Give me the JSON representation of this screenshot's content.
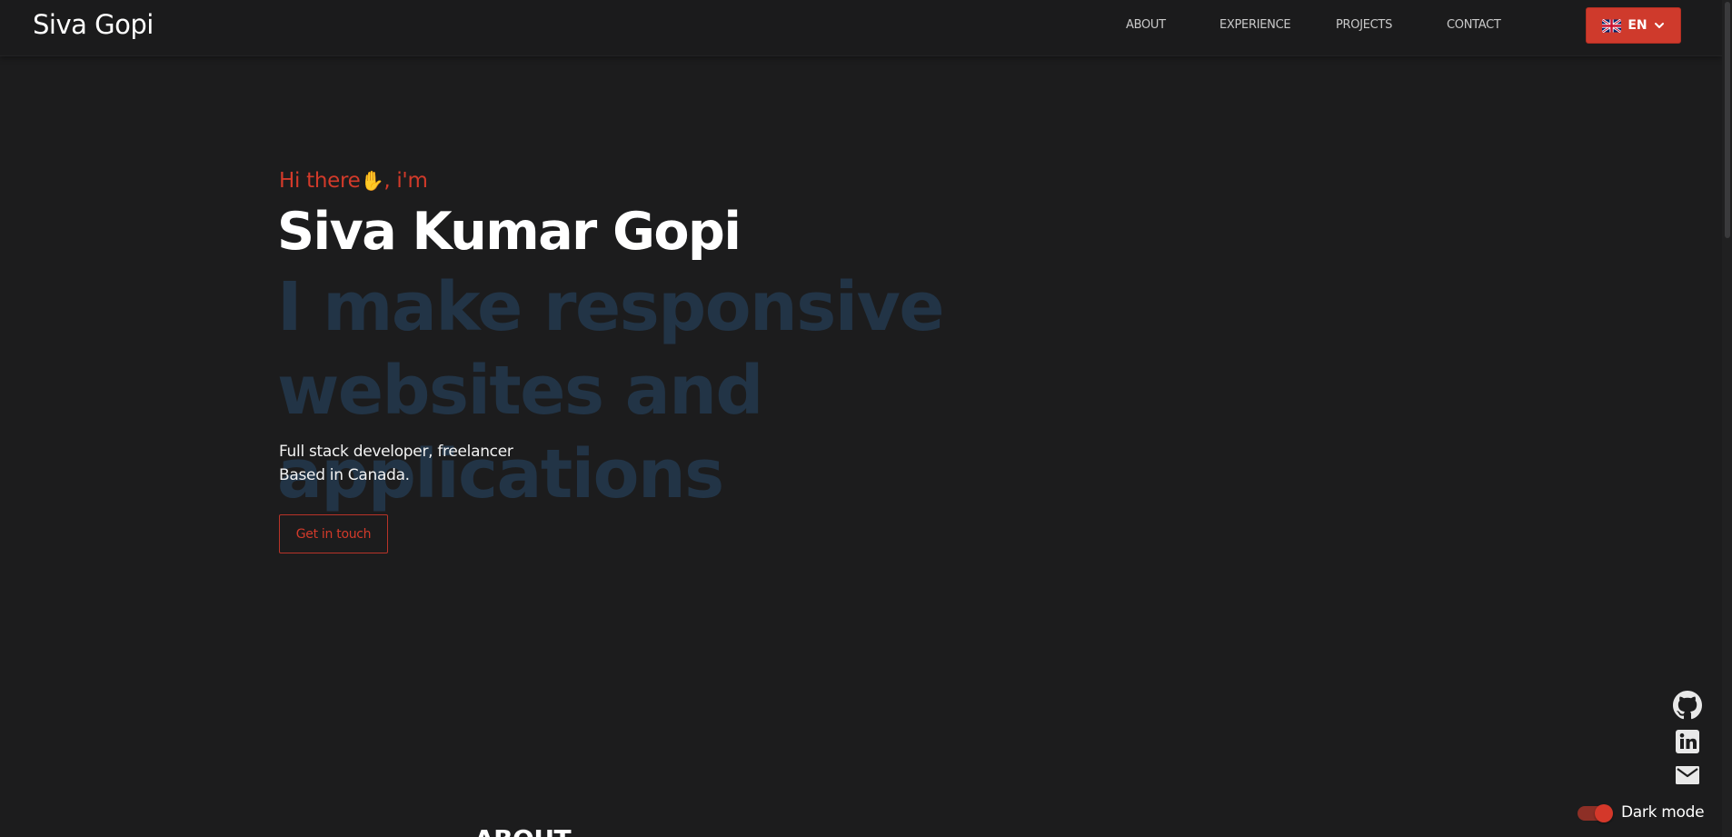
{
  "navbar": {
    "brand": "Siva Gopi",
    "links": [
      {
        "label": "ABOUT"
      },
      {
        "label": "EXPERIENCE"
      },
      {
        "label": "PROJECTS"
      },
      {
        "label": "CONTACT"
      }
    ],
    "language": {
      "code": "EN",
      "flag_icon": "uk-flag-icon",
      "color": "#cf3a2c"
    }
  },
  "hero": {
    "greeting_prefix": "Hi there",
    "greeting_emoji": "✋",
    "greeting_suffix": ", i'm",
    "name": "Siva Kumar Gopi",
    "tagline": "I make responsive websites and applications",
    "description_line1": "Full stack developer, freelancer",
    "description_line2": "Based in Canada.",
    "cta_label": "Get in touch"
  },
  "sections": {
    "about_heading": "ABOUT"
  },
  "social": [
    {
      "icon": "github-icon"
    },
    {
      "icon": "linkedin-icon"
    },
    {
      "icon": "mail-icon"
    }
  ],
  "theme": {
    "toggle_label": "Dark mode",
    "enabled": true,
    "accent": "#d23a2a",
    "background": "#1c1c1d"
  }
}
